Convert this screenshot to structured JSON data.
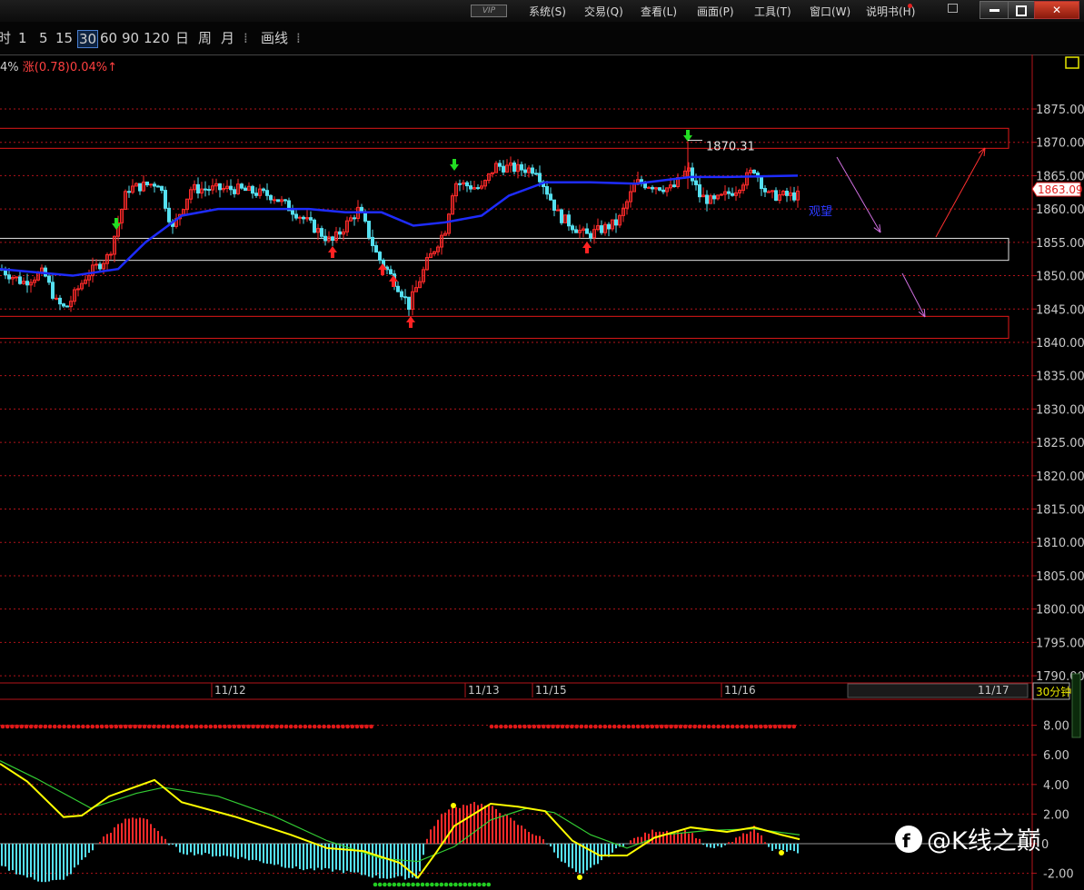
{
  "menubar": {
    "vip": "VIP",
    "items": [
      "系统(S)",
      "交易(Q)",
      "查看(L)",
      "画面(P)",
      "工具(T)",
      "窗口(W)",
      "说明书(H)"
    ]
  },
  "toolbar": {
    "items": [
      "时",
      "1",
      "5",
      "15",
      "30",
      "60",
      "90",
      "120",
      "日",
      "周",
      "月",
      "⁞",
      "画线",
      "⁞"
    ],
    "selected": "30"
  },
  "info": {
    "prefix": "4%",
    "text": "涨(0.78)0.04%↑"
  },
  "colors": {
    "up": "#ff2a2a",
    "down": "#55e0f0",
    "ma": "#1e2cff",
    "axis": "#b3131a",
    "dif": "#ffff00",
    "dea": "#33cc33"
  },
  "main_chart": {
    "price_ticks": [
      "1875.00",
      "1870.00",
      "1865.00",
      "1860.00",
      "1855.00",
      "1850.00",
      "1845.00",
      "1840.00",
      "1835.00",
      "1830.00",
      "1825.00",
      "1820.00",
      "1815.00",
      "1810.00",
      "1805.00",
      "1800.00",
      "1795.00",
      "1790.00"
    ],
    "current_price": "1863.09",
    "high_label": "1870.31",
    "annotation": "观望",
    "date_labels": [
      "11/12",
      "11/13",
      "11/15",
      "11/16"
    ],
    "scroll_date": "11/17",
    "period": "30分钟"
  },
  "macd": {
    "ticks": [
      "8.00",
      "6.00",
      "4.00",
      "2.00",
      "0",
      "-2.00"
    ]
  },
  "watermark": {
    "text": "@K线之巅"
  }
}
